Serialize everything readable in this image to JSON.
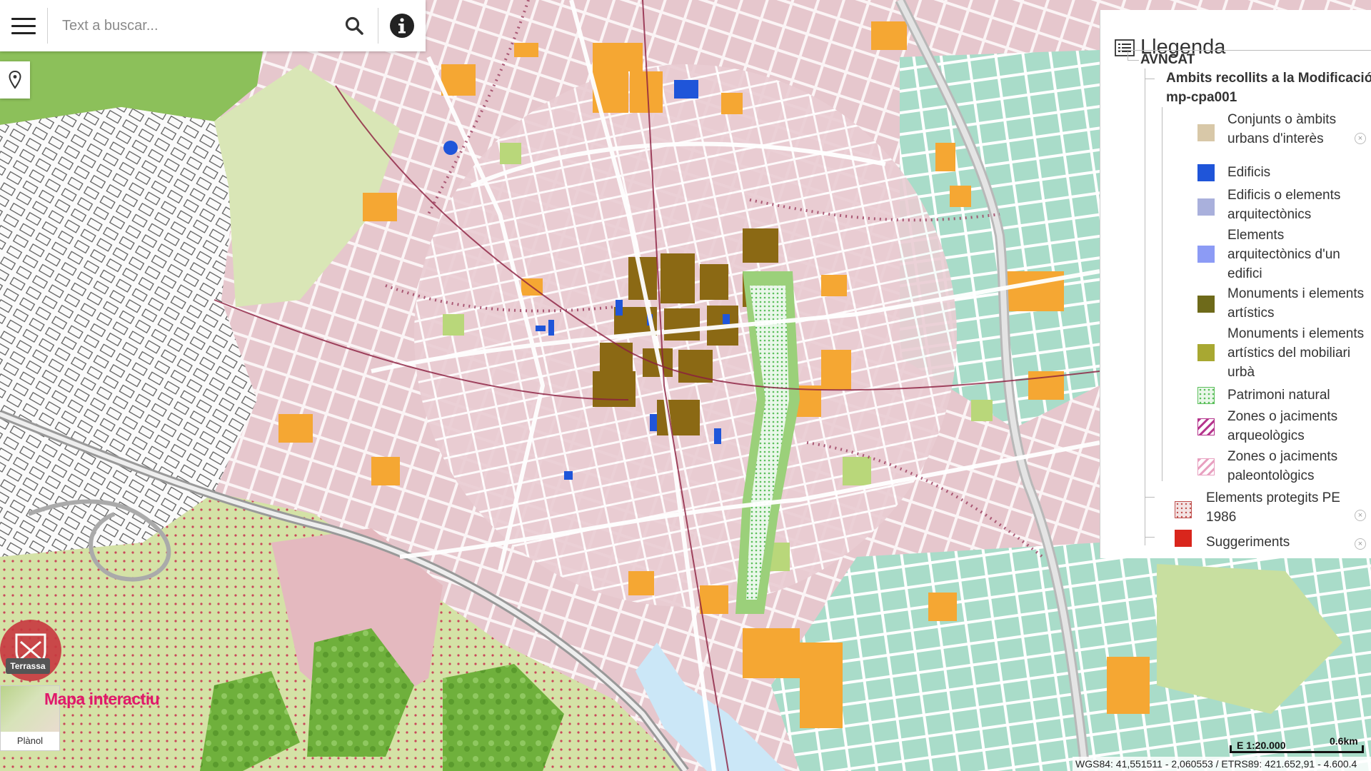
{
  "search": {
    "placeholder": "Text a buscar..."
  },
  "icons": {
    "menu": "menu-icon",
    "search": "search-icon",
    "info": "info-icon",
    "locate": "location-pin-icon",
    "legend": "list-icon"
  },
  "legend": {
    "title": "Llegenda",
    "group": "AVNCAT",
    "subgroup_line1": "Ambits recollits a la Modificació",
    "subgroup_line2": "mp-cpa001",
    "items": [
      {
        "label": "Conjunts o àmbits urbans d'interès",
        "color": "#d8c8a8"
      },
      {
        "label": "Edificis",
        "color": "#1f55d9"
      },
      {
        "label": "Edificis o elements arquitectònics",
        "color": "#a9b0dc"
      },
      {
        "label": "Elements arquitectònics d'un edifici",
        "color": "#8c9bf5"
      },
      {
        "label": "Monuments i elements artístics",
        "color": "#6e6a1a"
      },
      {
        "label": "Monuments i elements artístics del mobiliari urbà",
        "color": "#a8a832"
      },
      {
        "label": "Patrimoni natural",
        "color": "#7fd27f"
      },
      {
        "label": "Zones o jaciments arqueològics",
        "color": "#b5338c"
      },
      {
        "label": "Zones o jaciments paleontològics",
        "color": "#e8a0c0"
      }
    ],
    "extra": [
      {
        "label": "Elements protegits PE 1986",
        "color": "#c0504d"
      },
      {
        "label": "Suggeriments",
        "color": "#d9261c"
      }
    ]
  },
  "branding": {
    "logo_text": "Terrassa",
    "app_title": "Mapa interactiu"
  },
  "basemap": {
    "label": "Plànol"
  },
  "scale": {
    "ratio": "E 1:20.000",
    "distance": "0.6km"
  },
  "coords": {
    "text": "WGS84: 41,551511 - 2,060553 / ETRS89: 421.652,91 - 4.600.4"
  },
  "colors": {
    "urban_pink": "#e8c9cf",
    "orange": "#f5a733",
    "green": "#8bc34a",
    "teal": "#a8dcc8",
    "brown": "#8b6914",
    "street": "#ffffff",
    "accent": "#e0186b"
  }
}
